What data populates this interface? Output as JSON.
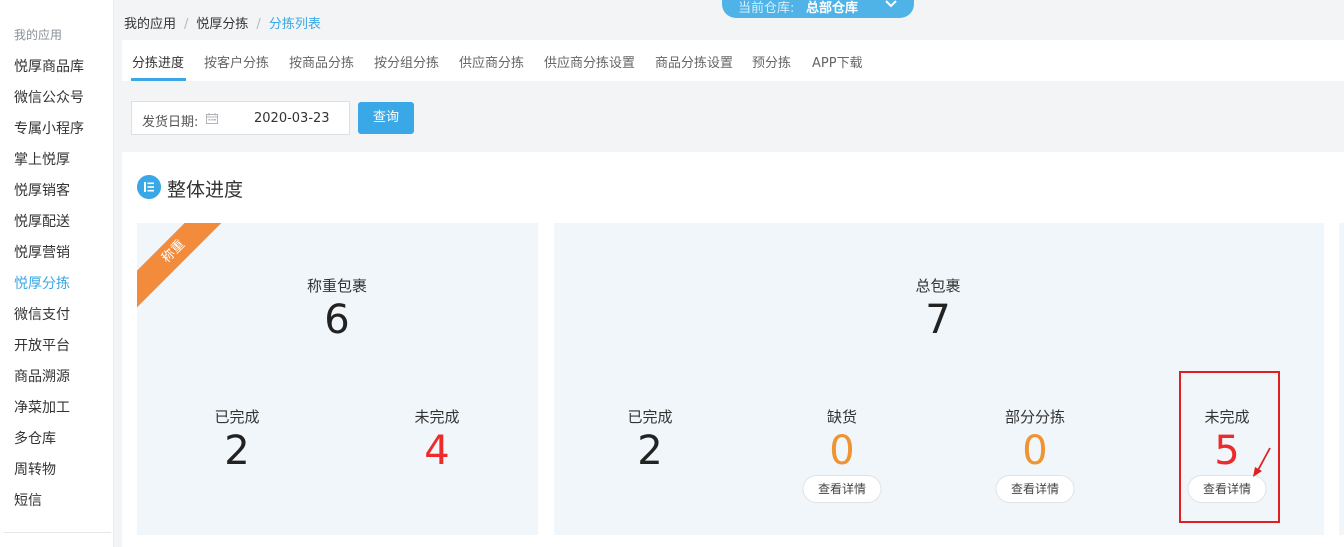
{
  "sidebar": {
    "title": "我的应用",
    "items": [
      {
        "label": "悦厚商品库"
      },
      {
        "label": "微信公众号"
      },
      {
        "label": "专属小程序"
      },
      {
        "label": "掌上悦厚"
      },
      {
        "label": "悦厚销客"
      },
      {
        "label": "悦厚配送"
      },
      {
        "label": "悦厚营销"
      },
      {
        "label": "悦厚分拣"
      },
      {
        "label": "微信支付"
      },
      {
        "label": "开放平台"
      },
      {
        "label": "商品溯源"
      },
      {
        "label": "净菜加工"
      },
      {
        "label": "多仓库"
      },
      {
        "label": "周转物"
      },
      {
        "label": "短信"
      }
    ]
  },
  "warehouse": {
    "label": "当前仓库:",
    "value": "总部仓库",
    "icon": "chevron-down-icon"
  },
  "breadcrumb": {
    "items": [
      "我的应用",
      "悦厚分拣",
      "分拣列表"
    ]
  },
  "tabs": [
    "分拣进度",
    "按客户分拣",
    "按商品分拣",
    "按分组分拣",
    "供应商分拣",
    "供应商分拣设置",
    "商品分拣设置",
    "预分拣",
    "APP下载"
  ],
  "filter": {
    "label": "发货日期:",
    "date": "2020-03-23",
    "query_label": "查询",
    "icon": "calendar-icon"
  },
  "section": {
    "title": "整体进度",
    "icon": "list-icon"
  },
  "weigh_card": {
    "ribbon": "称重",
    "title": "称重包裹",
    "total": "6",
    "done_label": "已完成",
    "done": "2",
    "pending_label": "未完成",
    "pending": "4"
  },
  "total_card": {
    "title": "总包裹",
    "total": "7",
    "done_label": "已完成",
    "done": "2",
    "shortage_label": "缺货",
    "shortage": "0",
    "partial_label": "部分分拣",
    "partial": "0",
    "pending_label": "未完成",
    "pending": "5",
    "detail_label": "查看详情"
  },
  "colors": {
    "accent": "#3aa8e6",
    "ribbon": "#f28b3c",
    "danger": "#ee2b2b",
    "warning": "#f09433",
    "annotation": "#e02020"
  }
}
